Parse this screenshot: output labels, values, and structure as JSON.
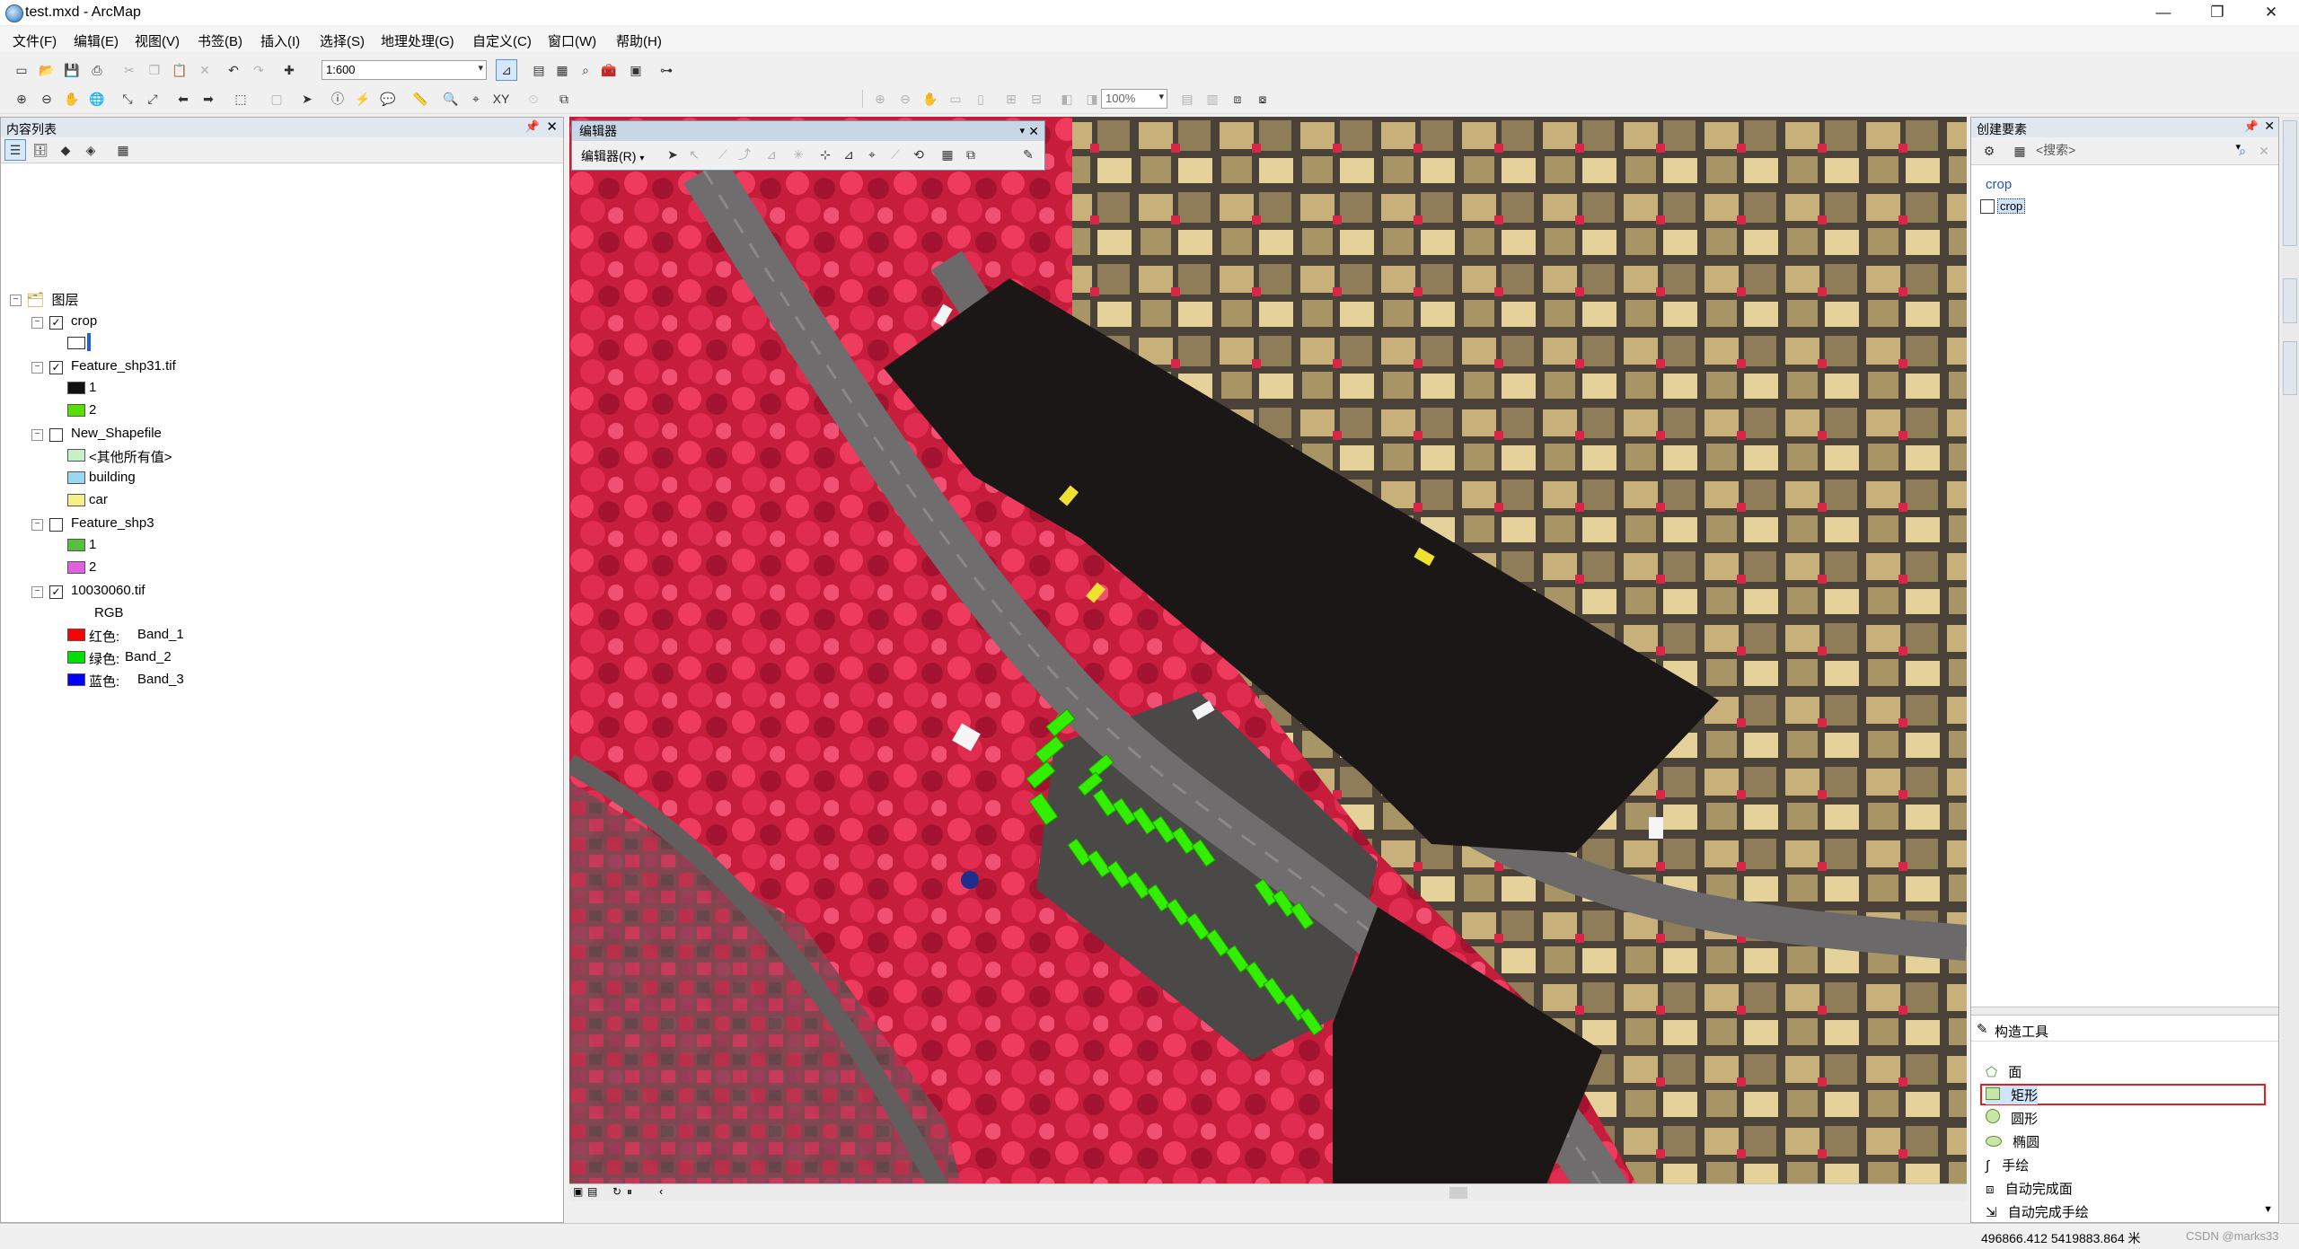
{
  "window": {
    "title": "test.mxd - ArcMap",
    "controls": [
      "—",
      "❐",
      "✕"
    ]
  },
  "menu": [
    "文件(F)",
    "编辑(E)",
    "视图(V)",
    "书签(B)",
    "插入(I)",
    "选择(S)",
    "地理处理(G)",
    "自定义(C)",
    "窗口(W)",
    "帮助(H)"
  ],
  "toolbar": {
    "scale": "1:600",
    "zoom_percent": "100%"
  },
  "toc": {
    "title": "内容列表",
    "root": "图层",
    "layers": [
      {
        "name": "crop",
        "checked": true
      },
      {
        "name": "Feature_shp31.tif",
        "checked": true,
        "legend": [
          {
            "label": "1",
            "color": "#111111"
          },
          {
            "label": "2",
            "color": "#55e000"
          }
        ]
      },
      {
        "name": "New_Shapefile",
        "checked": false,
        "legend": [
          {
            "label": "<其他所有值>",
            "color": "#c8f0c8"
          },
          {
            "label": "building",
            "color": "#9ad8f2"
          },
          {
            "label": "car",
            "color": "#f5f08a"
          }
        ]
      },
      {
        "name": "Feature_shp3",
        "checked": false,
        "legend": [
          {
            "label": "1",
            "color": "#55c040"
          },
          {
            "label": "2",
            "color": "#e060e0"
          }
        ]
      },
      {
        "name": "10030060.tif",
        "checked": true,
        "rgb_label": "RGB",
        "bands": [
          {
            "channel": "红色:",
            "band": "Band_1",
            "color": "#ff0000"
          },
          {
            "channel": "绿色:",
            "band": "Band_2",
            "color": "#00e000"
          },
          {
            "channel": "蓝色:",
            "band": "Band_3",
            "color": "#0000ff"
          }
        ]
      }
    ]
  },
  "editor": {
    "title": "编辑器",
    "menu_label": "编辑器(R)"
  },
  "create_features": {
    "title": "创建要素",
    "search_placeholder": "<搜索>",
    "group": "crop",
    "template": "crop",
    "construction_title": "构造工具",
    "tools": [
      "面",
      "矩形",
      "圆形",
      "椭圆",
      "手绘",
      "自动完成面",
      "自动完成手绘"
    ],
    "selected_tool": "矩形"
  },
  "status": {
    "coordinates": "496866.412  5419883.864 米",
    "watermark": "CSDN @marks33"
  },
  "colors": {
    "accent": "#5a8fd0",
    "highlight_box": "#e02020",
    "vegetation": "#d8264a",
    "crop_fill": "#1b1717",
    "car_green": "#33ee00"
  }
}
